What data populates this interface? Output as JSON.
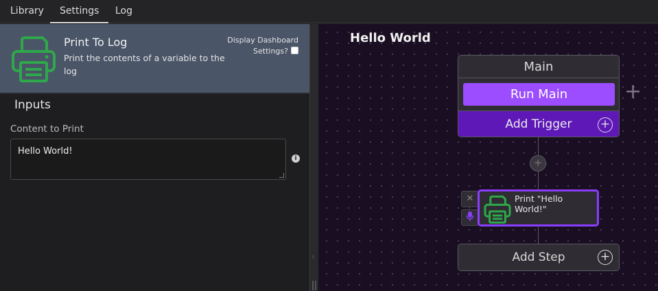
{
  "tabs": [
    {
      "label": "Library"
    },
    {
      "label": "Settings"
    },
    {
      "label": "Log"
    }
  ],
  "active_tab": "Settings",
  "action": {
    "title": "Print To Log",
    "description": "Print the contents of a variable to the log",
    "icon": "printer-icon",
    "icon_color": "#2ea84a",
    "dashboard_label": "Display Dashboard Settings?",
    "dashboard_checked": false
  },
  "inputs": {
    "heading": "Inputs",
    "fields": [
      {
        "label": "Content to Print",
        "value": "Hello World!",
        "info_icon": "info-icon"
      }
    ]
  },
  "canvas": {
    "title": "Hello World",
    "main": {
      "title": "Main",
      "run_label": "Run Main",
      "add_trigger_label": "Add Trigger"
    },
    "step": {
      "label": "Print \"Hello World!\"",
      "icon": "printer-icon"
    },
    "add_step_label": "Add Step",
    "accent_color": "#9b4dff",
    "trigger_color": "#5e18b8"
  }
}
